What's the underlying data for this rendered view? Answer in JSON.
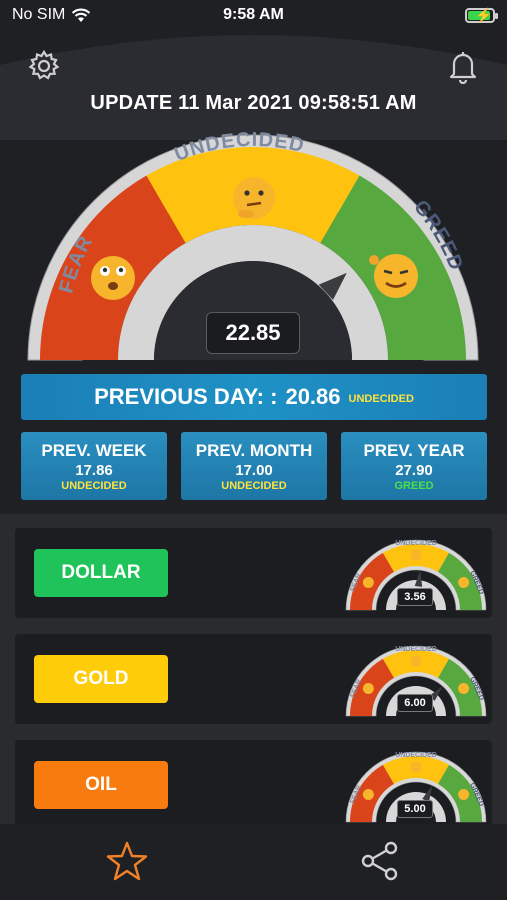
{
  "status": {
    "carrier": "No SIM",
    "time": "9:58 AM"
  },
  "update_text": "UPDATE 11 Mar 2021 09:58:51 AM",
  "main_gauge": {
    "fear_label": "FEAR",
    "undecided_label": "UNDECIDED",
    "greed_label": "GREED",
    "value": "22.85",
    "needle_value": 22.85,
    "colors": {
      "fear": "#d9441b",
      "undecided": "#ffc20f",
      "greed": "#57a83f",
      "frame": "#d8d8d8"
    }
  },
  "previous_day": {
    "label": "PREVIOUS DAY: :",
    "value": "20.86",
    "status": "UNDECIDED"
  },
  "prev_cards": [
    {
      "title": "PREV. WEEK",
      "value": "17.86",
      "status": "UNDECIDED",
      "status_color": "#ffe23d"
    },
    {
      "title": "PREV. MONTH",
      "value": "17.00",
      "status": "UNDECIDED",
      "status_color": "#ffe23d"
    },
    {
      "title": "PREV. YEAR",
      "value": "27.90",
      "status": "GREED",
      "status_color": "#4be14b"
    }
  ],
  "assets": [
    {
      "label": "DOLLAR",
      "color": "#20c35a",
      "value": "3.56",
      "needle_value": 16
    },
    {
      "label": "GOLD",
      "color": "#ffcc0a",
      "value": "6.00",
      "needle_value": 22
    },
    {
      "label": "OIL",
      "color": "#f77b0f",
      "value": "5.00",
      "needle_value": 19
    }
  ],
  "mini_labels": {
    "fear": "FEAR",
    "undecided": "UNDECIDED",
    "greed": "GREED"
  },
  "tab_bar": {
    "star_icon": "star-icon",
    "share_icon": "share-icon",
    "accent": "#f0822a"
  }
}
